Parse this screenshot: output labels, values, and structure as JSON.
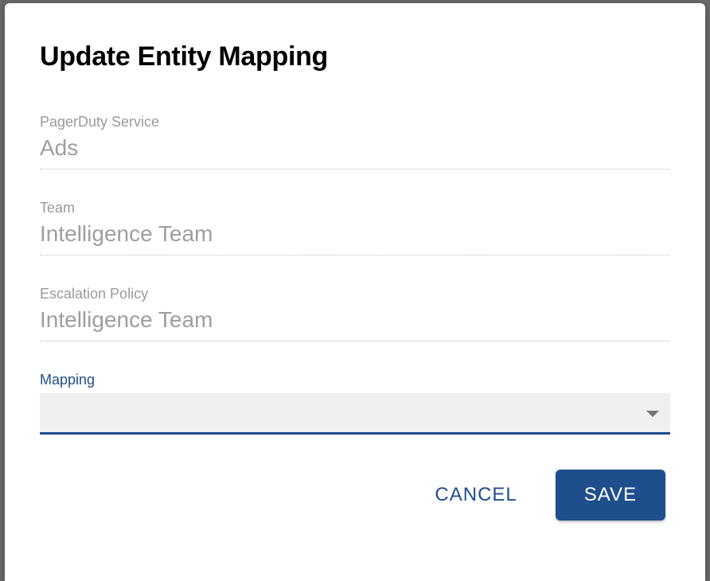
{
  "modal": {
    "title": "Update Entity Mapping",
    "fields": {
      "service": {
        "label": "PagerDuty Service",
        "value": "Ads"
      },
      "team": {
        "label": "Team",
        "value": "Intelligence Team"
      },
      "escalation": {
        "label": "Escalation Policy",
        "value": "Intelligence Team"
      },
      "mapping": {
        "label": "Mapping",
        "value": ""
      }
    },
    "actions": {
      "cancel": "CANCEL",
      "save": "SAVE"
    }
  }
}
